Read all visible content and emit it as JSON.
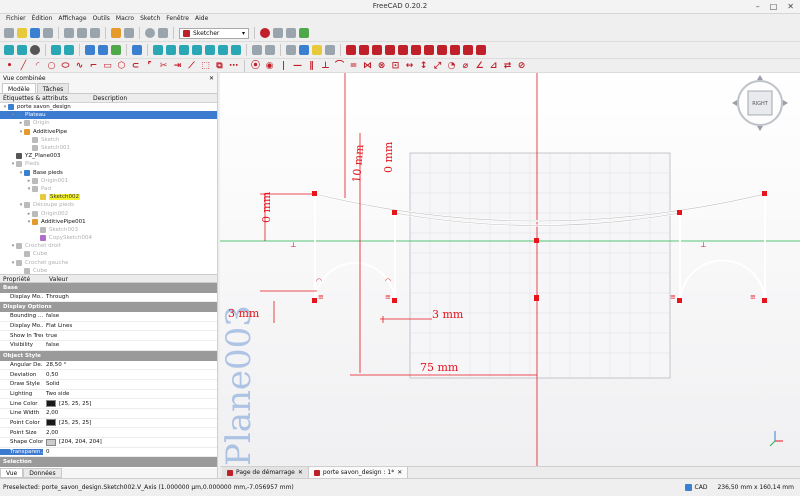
{
  "app": {
    "title": "FreeCAD 0.20.2"
  },
  "menu": [
    "Fichier",
    "Édition",
    "Affichage",
    "Outils",
    "Macro",
    "Sketch",
    "Fenêtre",
    "Aide"
  ],
  "toolbar": {
    "workbench": "Sketcher"
  },
  "combo_view": {
    "title": "Vue combinée",
    "tabs": [
      "Modèle",
      "Tâches"
    ],
    "tree_headers": [
      "Étiquettes & attributs",
      "Description"
    ],
    "tree": [
      {
        "label": "porte savon_design",
        "indent": 0,
        "icon": "document-icon",
        "color": "#3a7fd0",
        "state": "normal",
        "arrow": "▾"
      },
      {
        "label": "Plateau",
        "indent": 1,
        "icon": "body-icon",
        "color": "#3a7fd0",
        "state": "selected",
        "arrow": "▾"
      },
      {
        "label": "Origin",
        "indent": 2,
        "icon": "origin-icon",
        "color": "#bbbbbb",
        "state": "greyed",
        "arrow": "▸"
      },
      {
        "label": "AdditivePipe",
        "indent": 2,
        "icon": "pipe-icon",
        "color": "#e59a2c",
        "state": "normal",
        "arrow": "▾"
      },
      {
        "label": "Sketch",
        "indent": 3,
        "icon": "sketch-icon",
        "color": "#bbbbbb",
        "state": "greyed",
        "arrow": ""
      },
      {
        "label": "Sketch001",
        "indent": 3,
        "icon": "sketch-icon",
        "color": "#bbbbbb",
        "state": "greyed",
        "arrow": ""
      },
      {
        "label": "YZ_Plane003",
        "indent": 1,
        "icon": "plane-icon",
        "color": "#555555",
        "state": "normal",
        "arrow": ""
      },
      {
        "label": "Pieds",
        "indent": 1,
        "icon": "group-icon",
        "color": "#bbbbbb",
        "state": "greyed",
        "arrow": "▾"
      },
      {
        "label": "Base pieds",
        "indent": 2,
        "icon": "body-icon",
        "color": "#3a7fd0",
        "state": "normal",
        "arrow": "▾"
      },
      {
        "label": "Origin001",
        "indent": 3,
        "icon": "origin-icon",
        "color": "#bbbbbb",
        "state": "greyed",
        "arrow": "▸"
      },
      {
        "label": "Pad",
        "indent": 3,
        "icon": "pad-icon",
        "color": "#bbbbbb",
        "state": "greyed",
        "arrow": "▾"
      },
      {
        "label": "Sketch002",
        "indent": 4,
        "icon": "sketch-icon",
        "color": "#e7c93b",
        "state": "highlight",
        "arrow": ""
      },
      {
        "label": "Découpe pieds",
        "indent": 2,
        "icon": "body-icon",
        "color": "#bbbbbb",
        "state": "greyed",
        "arrow": "▾"
      },
      {
        "label": "Origin002",
        "indent": 3,
        "icon": "origin-icon",
        "color": "#bbbbbb",
        "state": "greyed",
        "arrow": "▸"
      },
      {
        "label": "AdditivePipe001",
        "indent": 3,
        "icon": "pipe-icon",
        "color": "#e59a2c",
        "state": "normal",
        "arrow": "▾"
      },
      {
        "label": "Sketch003",
        "indent": 4,
        "icon": "sketch-icon",
        "color": "#bbbbbb",
        "state": "greyed",
        "arrow": ""
      },
      {
        "label": "CopySketch004",
        "indent": 4,
        "icon": "sketch-icon",
        "color": "#b06cc8",
        "state": "greyed",
        "arrow": ""
      },
      {
        "label": "Crochet droit",
        "indent": 1,
        "icon": "group-icon",
        "color": "#bbbbbb",
        "state": "greyed",
        "arrow": "▾"
      },
      {
        "label": "Cube",
        "indent": 2,
        "icon": "cube-icon",
        "color": "#bbbbbb",
        "state": "greyed",
        "arrow": ""
      },
      {
        "label": "Crochet gauche",
        "indent": 1,
        "icon": "group-icon",
        "color": "#bbbbbb",
        "state": "greyed",
        "arrow": "▾"
      },
      {
        "label": "Cube",
        "indent": 2,
        "icon": "cube-icon",
        "color": "#bbbbbb",
        "state": "greyed",
        "arrow": ""
      }
    ],
    "prop_headers": [
      "Propriété",
      "Valeur"
    ],
    "props": [
      {
        "group": "Base"
      },
      {
        "name": "Display Mo...",
        "value": "Through"
      },
      {
        "group": "Display Options"
      },
      {
        "name": "Bounding ...",
        "value": "false"
      },
      {
        "name": "Display Mo...",
        "value": "Flat Lines"
      },
      {
        "name": "Show In Tree",
        "value": "true"
      },
      {
        "name": "Visibility",
        "value": "false"
      },
      {
        "group": "Object Style"
      },
      {
        "name": "Angular De...",
        "value": "28,50 °"
      },
      {
        "name": "Deviation",
        "value": "0,50"
      },
      {
        "name": "Draw Style",
        "value": "Solid"
      },
      {
        "name": "Lighting",
        "value": "Two side"
      },
      {
        "name": "Line Color",
        "value": "[25, 25, 25]",
        "swatch": "#191919"
      },
      {
        "name": "Line Width",
        "value": "2,00"
      },
      {
        "name": "Point Color",
        "value": "[25, 25, 25]",
        "swatch": "#191919"
      },
      {
        "name": "Point Size",
        "value": "2,00"
      },
      {
        "name": "Shape Color",
        "value": "[204, 204, 204]",
        "swatch": "#cccccc"
      },
      {
        "name": "Transparen...",
        "value": "0",
        "selected": true
      },
      {
        "group": "Selection"
      }
    ],
    "bottom_tabs": [
      "Vue",
      "Données"
    ]
  },
  "viewport": {
    "dimensions": {
      "d1": "0 mm",
      "d2": "0 mm",
      "d3": "10 mm",
      "d4": "3 mm",
      "d5": "3 mm",
      "d6": "75 mm"
    },
    "plane_label": "Plane003",
    "navcube_face": "RIGHT"
  },
  "doc_tabs": [
    {
      "label": "Page de démarrage",
      "active": false
    },
    {
      "label": "porte savon_design : 1*",
      "active": true
    }
  ],
  "status": {
    "message": "Preselected: porte_savon_design.Sketch002.V_Axis (1.000000 µm,0.000000 mm,-7.056957 mm)",
    "nav": "CAD",
    "dims": "236,50 mm x 160,14 mm"
  },
  "colors": {
    "sketch_red": "#e8141c",
    "selected": "#3d7bd1",
    "axis_green": "#22b04a"
  }
}
